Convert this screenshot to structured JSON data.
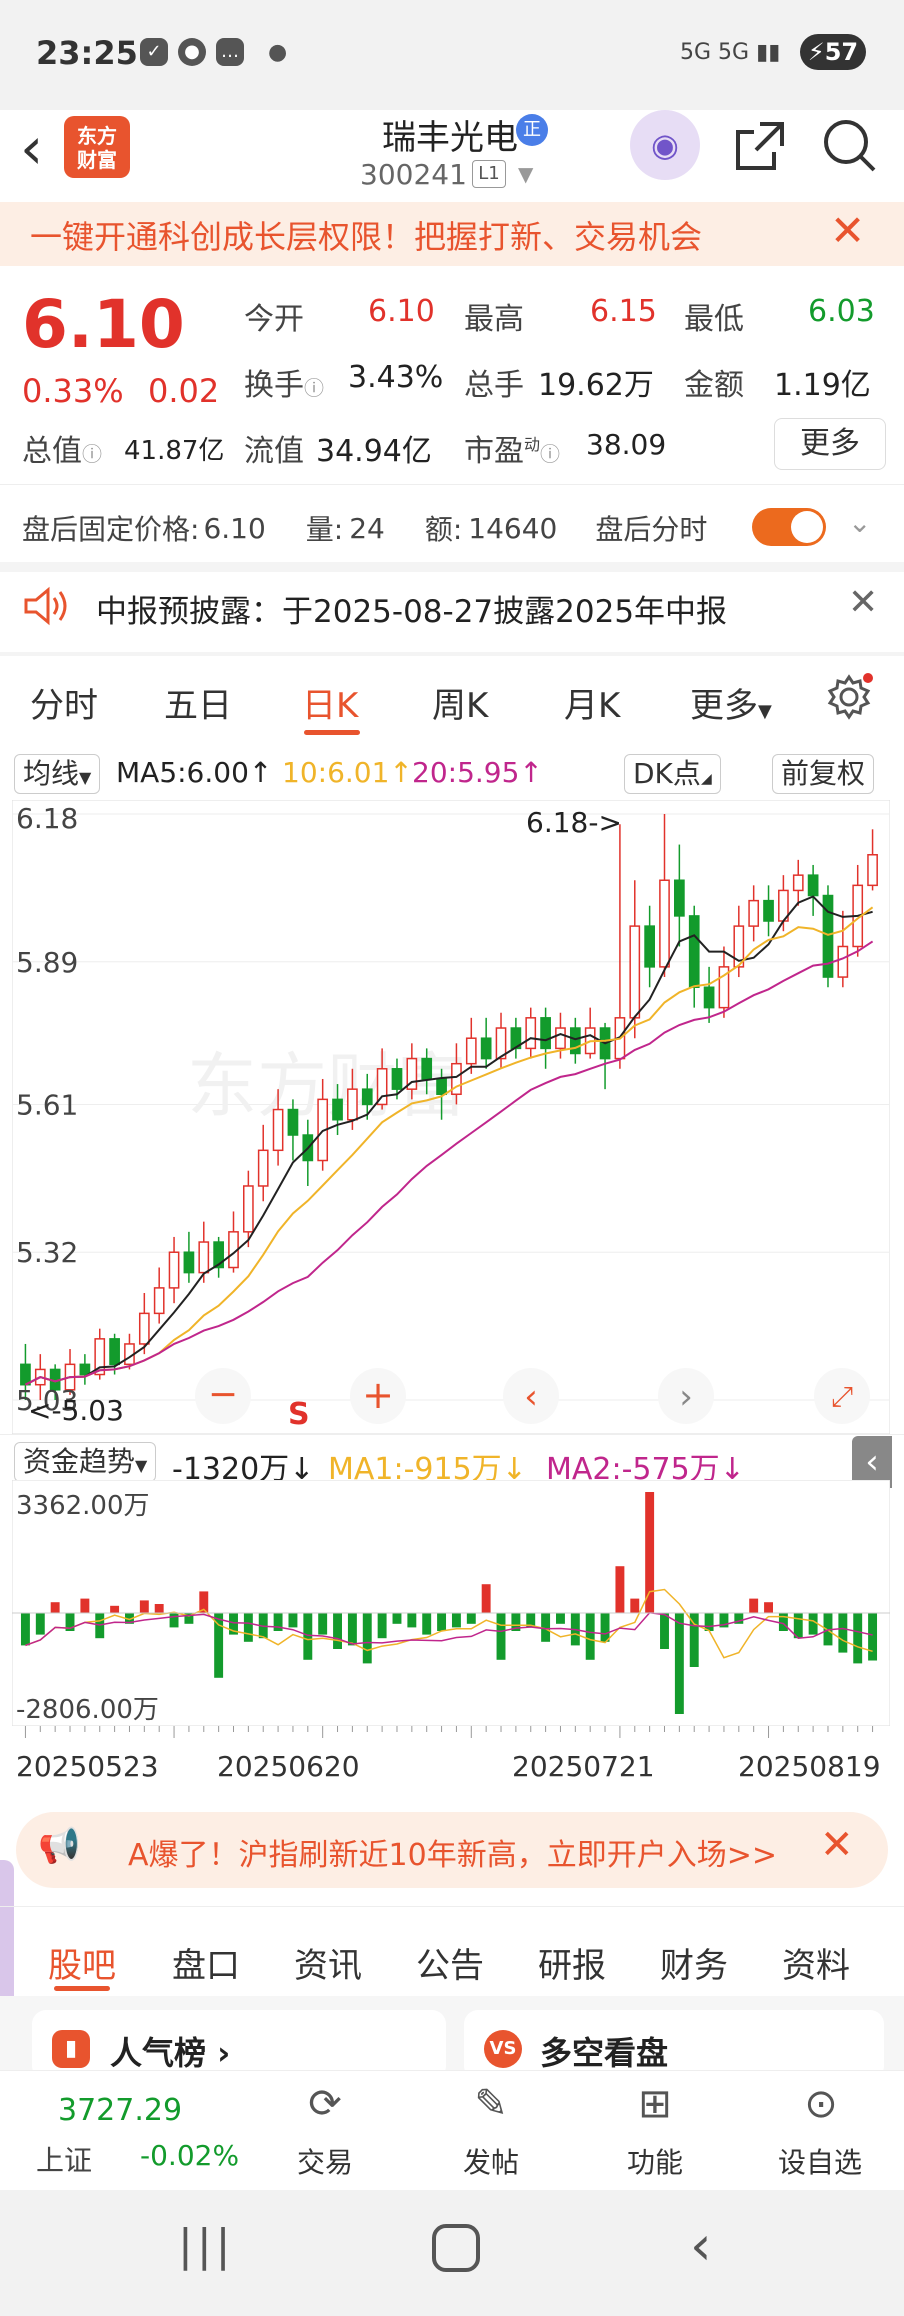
{
  "status": {
    "time": "23:25",
    "battery": "57",
    "network": "5G 5G"
  },
  "title": {
    "name": "瑞丰光电",
    "badge": "正",
    "code": "300241",
    "level": "L1"
  },
  "banner": {
    "text": "一键开通科创成长层权限！把握打新、交易机会"
  },
  "quote": {
    "price": "6.10",
    "pct": "0.33%",
    "change": "0.02",
    "open_label": "今开",
    "open": "6.10",
    "high_label": "最高",
    "high": "6.15",
    "low_label": "最低",
    "low": "6.03",
    "turnover_label": "换手",
    "turnover": "3.43%",
    "volume_label": "总手",
    "volume": "19.62万",
    "amount_label": "金额",
    "amount": "1.19亿",
    "mcap_label": "总值",
    "mcap": "41.87亿",
    "float_label": "流值",
    "float": "34.94亿",
    "pe_label": "市盈",
    "pe_sup": "动",
    "pe": "38.09",
    "more": "更多"
  },
  "afterhours": {
    "price_label": "盘后固定价格:",
    "price": "6.10",
    "vol_label": "量:",
    "vol": "24",
    "amt_label": "额:",
    "amt": "14640",
    "time_label": "盘后分时"
  },
  "notice": {
    "text": "中报预披露：于2025-08-27披露2025年中报"
  },
  "tabs": [
    "分时",
    "五日",
    "日K",
    "周K",
    "月K",
    "更多"
  ],
  "ma": {
    "selector": "均线",
    "ma5": "MA5:6.00↑",
    "ma10": "10:6.01↑",
    "ma20": "20:5.95↑",
    "dk": "DK点",
    "adj": "前复权"
  },
  "colors": {
    "up": "#e1322b",
    "down": "#139b2c",
    "ma5": "#222222",
    "ma10": "#f0b429",
    "ma20": "#c0268c",
    "accent": "#e8542e"
  },
  "kchart": {
    "y_labels": [
      "6.18",
      "5.89",
      "5.61",
      "5.32",
      "5.03"
    ],
    "max_marker": "6.18->",
    "min_marker": "<-5.03",
    "s_marker": "S",
    "ylim": [
      5.03,
      6.18
    ]
  },
  "fund": {
    "selector": "资金趋势",
    "value": "-1320万↓",
    "ma1": "MA1:-915万↓",
    "ma2": "MA2:-575万↓",
    "ytop": "3362.00万",
    "ybot": "-2806.00万"
  },
  "dates": [
    "20250523",
    "20250620",
    "20250721",
    "20250819"
  ],
  "promo": {
    "text": "A爆了！沪指刷新近10年新高，立即开户入场>>"
  },
  "bottom_tabs": [
    "股吧",
    "盘口",
    "资讯",
    "公告",
    "研报",
    "财务",
    "资料"
  ],
  "cards": {
    "left": "人气榜",
    "right": "多空看盘"
  },
  "nav": {
    "index_value": "3727.29",
    "index_name": "上证",
    "index_change": "-0.02%",
    "trade": "交易",
    "post": "发帖",
    "func": "功能",
    "watch": "设自选"
  },
  "chart_data": {
    "type": "candlestick",
    "title": "",
    "ylim": [
      5.03,
      6.18
    ],
    "candles": [
      [
        5.1,
        5.06,
        5.14,
        5.03
      ],
      [
        5.06,
        5.09,
        5.12,
        5.03
      ],
      [
        5.09,
        5.05,
        5.1,
        5.03
      ],
      [
        5.05,
        5.1,
        5.13,
        5.04
      ],
      [
        5.1,
        5.08,
        5.12,
        5.06
      ],
      [
        5.08,
        5.15,
        5.17,
        5.07
      ],
      [
        5.15,
        5.1,
        5.16,
        5.08
      ],
      [
        5.1,
        5.14,
        5.16,
        5.09
      ],
      [
        5.14,
        5.2,
        5.24,
        5.12
      ],
      [
        5.2,
        5.25,
        5.29,
        5.18
      ],
      [
        5.25,
        5.32,
        5.35,
        5.22
      ],
      [
        5.32,
        5.28,
        5.36,
        5.26
      ],
      [
        5.28,
        5.34,
        5.38,
        5.26
      ],
      [
        5.34,
        5.29,
        5.35,
        5.27
      ],
      [
        5.29,
        5.36,
        5.4,
        5.28
      ],
      [
        5.36,
        5.45,
        5.48,
        5.33
      ],
      [
        5.45,
        5.52,
        5.57,
        5.42
      ],
      [
        5.52,
        5.6,
        5.64,
        5.49
      ],
      [
        5.6,
        5.55,
        5.62,
        5.5
      ],
      [
        5.55,
        5.5,
        5.58,
        5.45
      ],
      [
        5.5,
        5.62,
        5.66,
        5.48
      ],
      [
        5.62,
        5.58,
        5.65,
        5.55
      ],
      [
        5.58,
        5.64,
        5.68,
        5.56
      ],
      [
        5.64,
        5.61,
        5.67,
        5.58
      ],
      [
        5.61,
        5.68,
        5.72,
        5.6
      ],
      [
        5.68,
        5.64,
        5.7,
        5.62
      ],
      [
        5.64,
        5.7,
        5.73,
        5.62
      ],
      [
        5.7,
        5.66,
        5.72,
        5.63
      ],
      [
        5.66,
        5.63,
        5.68,
        5.58
      ],
      [
        5.63,
        5.69,
        5.73,
        5.61
      ],
      [
        5.69,
        5.74,
        5.78,
        5.67
      ],
      [
        5.74,
        5.7,
        5.78,
        5.68
      ],
      [
        5.7,
        5.76,
        5.79,
        5.68
      ],
      [
        5.76,
        5.72,
        5.78,
        5.7
      ],
      [
        5.72,
        5.78,
        5.8,
        5.7
      ],
      [
        5.78,
        5.72,
        5.8,
        5.68
      ],
      [
        5.72,
        5.76,
        5.79,
        5.7
      ],
      [
        5.76,
        5.71,
        5.78,
        5.69
      ],
      [
        5.71,
        5.76,
        5.8,
        5.7
      ],
      [
        5.76,
        5.7,
        5.77,
        5.64
      ],
      [
        5.7,
        5.78,
        6.16,
        5.68
      ],
      [
        5.78,
        5.96,
        6.05,
        5.74
      ],
      [
        5.96,
        5.88,
        6.0,
        5.84
      ],
      [
        5.88,
        6.05,
        6.18,
        5.86
      ],
      [
        6.05,
        5.98,
        6.12,
        5.92
      ],
      [
        5.98,
        5.84,
        6.0,
        5.8
      ],
      [
        5.84,
        5.8,
        5.88,
        5.77
      ],
      [
        5.8,
        5.88,
        5.92,
        5.78
      ],
      [
        5.88,
        5.96,
        6.0,
        5.86
      ],
      [
        5.96,
        6.01,
        6.04,
        5.93
      ],
      [
        6.01,
        5.97,
        6.04,
        5.94
      ],
      [
        5.97,
        6.03,
        6.06,
        5.95
      ],
      [
        6.03,
        6.06,
        6.09,
        6.0
      ],
      [
        6.06,
        6.02,
        6.08,
        5.98
      ],
      [
        6.02,
        5.86,
        6.04,
        5.84
      ],
      [
        5.86,
        5.92,
        5.99,
        5.84
      ],
      [
        5.92,
        6.04,
        6.08,
        5.9
      ],
      [
        6.04,
        6.1,
        6.15,
        6.03
      ]
    ],
    "fund_values": [
      -900,
      -600,
      300,
      -500,
      400,
      -700,
      200,
      -300,
      350,
      250,
      -400,
      -300,
      600,
      -1800,
      -600,
      -800,
      -700,
      -500,
      -400,
      -1300,
      -600,
      -1000,
      -900,
      -1400,
      -700,
      -300,
      -400,
      -600,
      -500,
      -400,
      -300,
      800,
      -1300,
      -500,
      -400,
      -800,
      -300,
      -900,
      -1300,
      -800,
      1300,
      400,
      3362,
      -1000,
      -2806,
      -1500,
      -500,
      -400,
      -300,
      400,
      300,
      -500,
      -700,
      -600,
      -900,
      -1100,
      -1400,
      -1320
    ]
  }
}
